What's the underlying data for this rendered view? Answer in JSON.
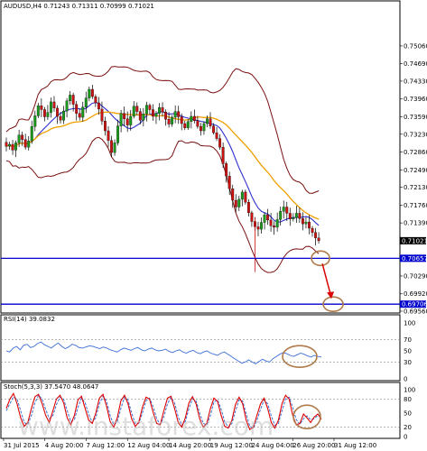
{
  "chart_data": [
    {
      "panel": "price",
      "type": "candlestick",
      "title": "AUDUSD,H4  0.71243 0.71311 0.70999 0.71021",
      "ylim": [
        0.6956,
        0.7575
      ],
      "y_ticks": [
        "0.75060",
        "0.74690",
        "0.74330",
        "0.73960",
        "0.73590",
        "0.73230",
        "0.72860",
        "0.72490",
        "0.72130",
        "0.71760",
        "0.71390",
        "0.70290",
        "0.69920",
        "0.69560"
      ],
      "y_tick_values": [
        0.7506,
        0.7469,
        0.7433,
        0.7396,
        0.7359,
        0.7323,
        0.7286,
        0.7249,
        0.7213,
        0.7176,
        0.7139,
        0.7029,
        0.6992,
        0.6956
      ],
      "current_price": {
        "label": "0.71021",
        "value": 0.71021
      },
      "horizontal_levels": [
        {
          "label": "0.70657",
          "value": 0.70657,
          "color": "#0000cc"
        },
        {
          "label": "0.69706",
          "value": 0.69706,
          "color": "#0000cc"
        }
      ],
      "x_ticks": [
        "31 Jul 2015",
        "4 Aug 20:00",
        "7 Aug 12:00",
        "12 Aug 04:00",
        "14 Aug 20:00",
        "19 Aug 12:00",
        "24 Aug 04:00",
        "26 Aug 20:00",
        "31 Aug 12:00"
      ],
      "close_series": [
        0.7298,
        0.7302,
        0.729,
        0.7305,
        0.7321,
        0.7312,
        0.7296,
        0.7309,
        0.7339,
        0.7361,
        0.7382,
        0.7374,
        0.7359,
        0.7368,
        0.739,
        0.7377,
        0.736,
        0.7352,
        0.7371,
        0.7392,
        0.7404,
        0.7385,
        0.7366,
        0.7358,
        0.7379,
        0.7398,
        0.7416,
        0.7401,
        0.7388,
        0.7375,
        0.735,
        0.733,
        0.731,
        0.7285,
        0.7305,
        0.734,
        0.7366,
        0.7355,
        0.7342,
        0.736,
        0.7381,
        0.737,
        0.7352,
        0.7365,
        0.7383,
        0.7374,
        0.736,
        0.7366,
        0.7378,
        0.7369,
        0.7354,
        0.7344,
        0.7358,
        0.737,
        0.7359,
        0.7345,
        0.7336,
        0.7349,
        0.736,
        0.7351,
        0.7339,
        0.733,
        0.7345,
        0.7355,
        0.734,
        0.7326,
        0.7314,
        0.7296,
        0.7262,
        0.7236,
        0.721,
        0.7186,
        0.7172,
        0.7188,
        0.7203,
        0.7182,
        0.716,
        0.7142,
        0.7131,
        0.7126,
        0.714,
        0.7156,
        0.7145,
        0.7133,
        0.713,
        0.7146,
        0.7163,
        0.7172,
        0.7159,
        0.7147,
        0.715,
        0.7159,
        0.7148,
        0.7137,
        0.7141,
        0.7128,
        0.7119,
        0.7108,
        0.7102
      ],
      "series": [
        {
          "name": "Bollinger Bands",
          "color": "#7a0f0f"
        },
        {
          "name": "MA fast",
          "color": "#3030d0"
        },
        {
          "name": "MA slow",
          "color": "#f0a000"
        }
      ],
      "arrow": {
        "from": 0.70657,
        "to": 0.69706,
        "color": "#dd0000"
      }
    },
    {
      "panel": "rsi",
      "type": "line",
      "title": "RSI(14) 39.0832",
      "ylim": [
        0,
        100
      ],
      "y_ticks": [
        "100",
        "70",
        "50",
        "30",
        "0"
      ],
      "y_tick_values": [
        100,
        70,
        50,
        30,
        0
      ],
      "values": [
        50,
        48,
        55,
        58,
        52,
        60,
        62,
        56,
        58,
        63,
        66,
        61,
        58,
        55,
        60,
        64,
        58,
        54,
        57,
        62,
        60,
        56,
        55,
        57,
        59,
        58,
        56,
        54,
        57,
        55,
        52,
        50,
        48,
        52,
        55,
        53,
        51,
        54,
        56,
        52,
        50,
        53,
        55,
        52,
        50,
        51,
        53,
        49,
        47,
        50,
        52,
        48,
        46,
        49,
        51,
        47,
        45,
        48,
        50,
        46,
        44,
        42,
        46,
        48,
        44,
        40,
        36,
        32,
        28,
        30,
        34,
        30,
        27,
        31,
        35,
        32,
        30,
        36,
        40,
        44,
        47,
        45,
        42,
        40,
        43,
        46,
        44,
        41,
        39,
        42,
        40,
        39
      ],
      "color": "#3a6fd8"
    },
    {
      "panel": "stochastic",
      "type": "line",
      "title": "Stoch(5,3,3) 37.5470 48.0647",
      "ylim": [
        0,
        100
      ],
      "y_ticks": [
        "100",
        "80",
        "50",
        "20",
        "0"
      ],
      "y_tick_values": [
        100,
        80,
        50,
        20,
        0
      ],
      "main": [
        60,
        80,
        92,
        70,
        40,
        22,
        30,
        60,
        85,
        90,
        70,
        45,
        30,
        55,
        80,
        88,
        72,
        40,
        25,
        45,
        78,
        86,
        60,
        35,
        28,
        50,
        82,
        90,
        65,
        32,
        20,
        40,
        76,
        88,
        70,
        38,
        22,
        30,
        62,
        84,
        80,
        52,
        28,
        25,
        55,
        82,
        86,
        60,
        30,
        20,
        40,
        72,
        85,
        70,
        38,
        20,
        28,
        60,
        82,
        75,
        45,
        22,
        18,
        35,
        68,
        84,
        70,
        35,
        15,
        20,
        45,
        70,
        82,
        60,
        30,
        18,
        35,
        70,
        88,
        80,
        45,
        25,
        28,
        48,
        40,
        30,
        42,
        48,
        37
      ],
      "signal": [
        55,
        70,
        85,
        80,
        55,
        30,
        26,
        45,
        72,
        88,
        80,
        58,
        38,
        45,
        68,
        84,
        80,
        55,
        32,
        36,
        62,
        82,
        72,
        48,
        30,
        40,
        70,
        86,
        76,
        45,
        25,
        32,
        60,
        84,
        78,
        50,
        28,
        28,
        50,
        76,
        82,
        64,
        38,
        26,
        42,
        70,
        84,
        72,
        42,
        24,
        32,
        60,
        80,
        76,
        50,
        28,
        25,
        45,
        74,
        78,
        58,
        32,
        20,
        28,
        54,
        78,
        76,
        48,
        22,
        18,
        35,
        58,
        78,
        70,
        44,
        24,
        28,
        55,
        80,
        84,
        62,
        36,
        26,
        38,
        44,
        36,
        38,
        45,
        48
      ],
      "colors": {
        "main": "#dd0000",
        "signal": "#3a6fd8"
      }
    }
  ],
  "watermark": "www.instaforex.com"
}
